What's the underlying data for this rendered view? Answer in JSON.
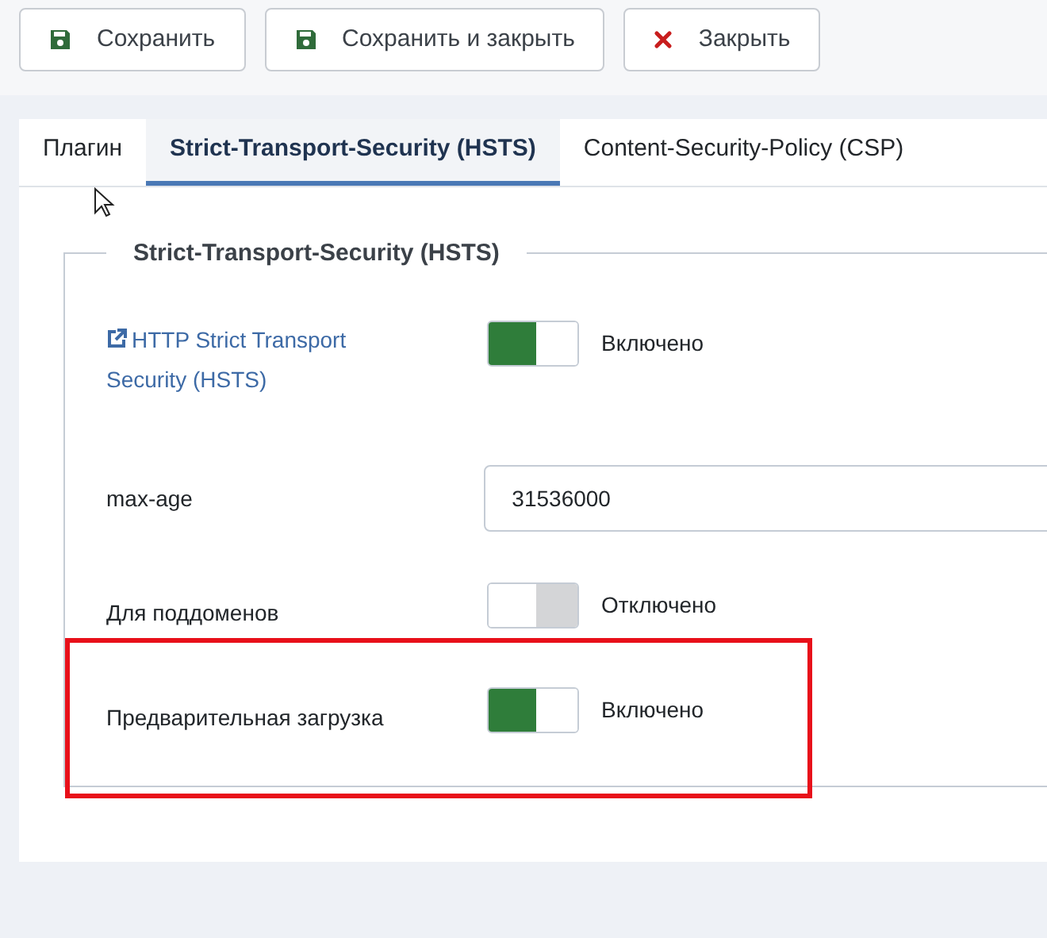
{
  "toolbar": [
    {
      "label": "Сохранить",
      "kind": "save"
    },
    {
      "label": "Сохранить и закрыть",
      "kind": "save"
    },
    {
      "label": "Закрыть",
      "kind": "close"
    }
  ],
  "tabs": [
    {
      "label": "Плагин",
      "selected": false
    },
    {
      "label": "Strict-Transport-Security (HSTS)",
      "selected": true
    },
    {
      "label": "Content-Security-Policy (CSP)",
      "selected": false
    }
  ],
  "fieldset": {
    "legend": "Strict-Transport-Security (HSTS)",
    "fields": [
      {
        "kind": "toggle",
        "label": "HTTP Strict Transport Security (HSTS)",
        "link": true,
        "on": true,
        "state_label": "Включено",
        "highlighted": false
      },
      {
        "kind": "text",
        "label": "max-age",
        "value": "31536000",
        "highlighted": false
      },
      {
        "kind": "toggle",
        "label": "Для поддоменов",
        "link": false,
        "on": false,
        "state_label": "Отключено",
        "highlighted": false
      },
      {
        "kind": "toggle",
        "label": "Предварительная загрузка",
        "link": false,
        "on": true,
        "state_label": "Включено",
        "highlighted": true
      }
    ]
  }
}
